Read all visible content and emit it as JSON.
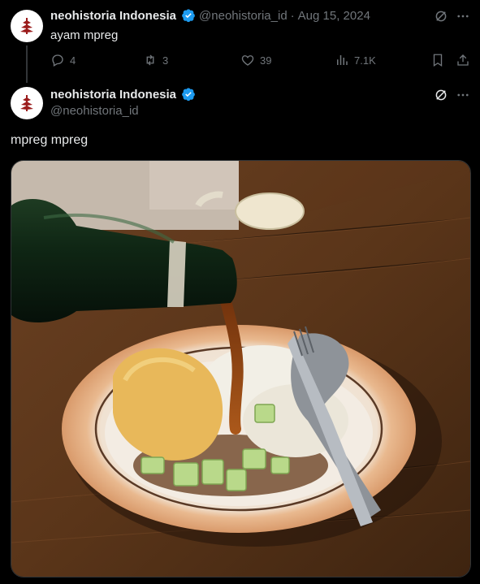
{
  "colors": {
    "background": "#000000",
    "text": "#e7e9ea",
    "muted": "#71767b",
    "verified": "#1d9bf0",
    "brand": "#8b1a1a"
  },
  "tweet1": {
    "author_name": "neohistoria Indonesia",
    "handle": "@neohistoria_id",
    "separator": "·",
    "date": "Aug 15, 2024",
    "text": "ayam mpreg",
    "actions": {
      "replies": "4",
      "reposts": "3",
      "likes": "39",
      "views": "7.1K"
    },
    "icons": [
      "grok-icon",
      "more-icon",
      "reply-icon",
      "repost-icon",
      "like-icon",
      "views-icon",
      "bookmark-icon",
      "share-icon"
    ]
  },
  "tweet2": {
    "author_name": "neohistoria Indonesia",
    "handle": "@neohistoria_id",
    "text": "mpreg mpreg",
    "image": "photo of a bottle pouring brown sauce onto a plate of rice, tofu and cucumber with spoon and fork"
  }
}
